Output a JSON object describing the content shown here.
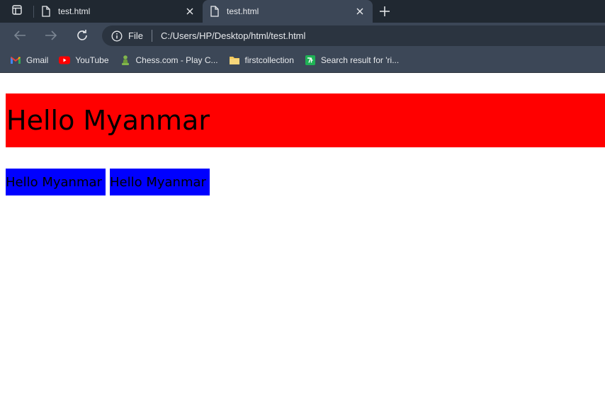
{
  "browser": {
    "tabs": [
      {
        "title": "test.html",
        "active": false
      },
      {
        "title": "test.html",
        "active": true
      }
    ],
    "address": {
      "scheme_label": "File",
      "url": "C:/Users/HP/Desktop/html/test.html"
    },
    "bookmarks": [
      {
        "label": "Gmail",
        "icon": "gmail-icon"
      },
      {
        "label": "YouTube",
        "icon": "youtube-icon"
      },
      {
        "label": "Chess.com - Play C...",
        "icon": "chess-pawn-icon"
      },
      {
        "label": "firstcollection",
        "icon": "folder-icon"
      },
      {
        "label": "Search result for 'ri...",
        "icon": "green-ga-icon"
      }
    ]
  },
  "page": {
    "heading": "Hello Myanmar",
    "boxes": [
      "Hello Myanmar",
      "Hello Myanmar"
    ]
  },
  "colors": {
    "heading_bg": "#ff0000",
    "box_bg": "#0000ff"
  }
}
